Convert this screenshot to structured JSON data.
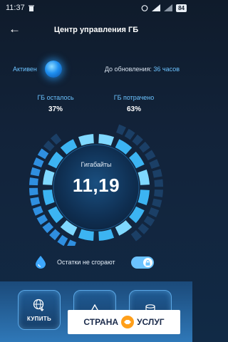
{
  "status_bar": {
    "time": "11:37",
    "battery": "84"
  },
  "header": {
    "title": "Центр управления ГБ"
  },
  "status": {
    "active_label": "Активен",
    "update_prefix": "До обновления:",
    "update_hours": "36 часов"
  },
  "stats": {
    "left": {
      "label": "ГБ осталось",
      "value": "37%"
    },
    "right": {
      "label": "ГБ потрачено",
      "value": "63%"
    }
  },
  "gauge": {
    "label": "Гигабайты",
    "value": "11,19",
    "remaining_fraction": 0.37
  },
  "rollover": {
    "text": "Остатки не сгорают",
    "enabled": true
  },
  "actions": [
    {
      "label": "КУПИТЬ"
    }
  ],
  "watermark": {
    "left": "СТРАНА",
    "right": "УСЛУГ"
  },
  "colors": {
    "accent": "#6cc3ff",
    "background": "#0f1b2b",
    "bar": "#2f78b8"
  }
}
